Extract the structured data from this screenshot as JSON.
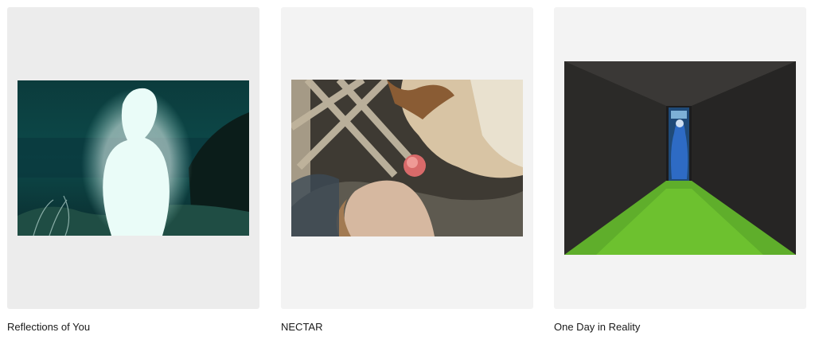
{
  "projects": [
    {
      "title": "Reflections of You",
      "image": "portrait-glowing-figure-night-coast"
    },
    {
      "title": "NECTAR",
      "image": "two-figures-rose-lattice"
    },
    {
      "title": "One Day in Reality",
      "image": "dark-room-green-floor-blue-figure"
    }
  ]
}
